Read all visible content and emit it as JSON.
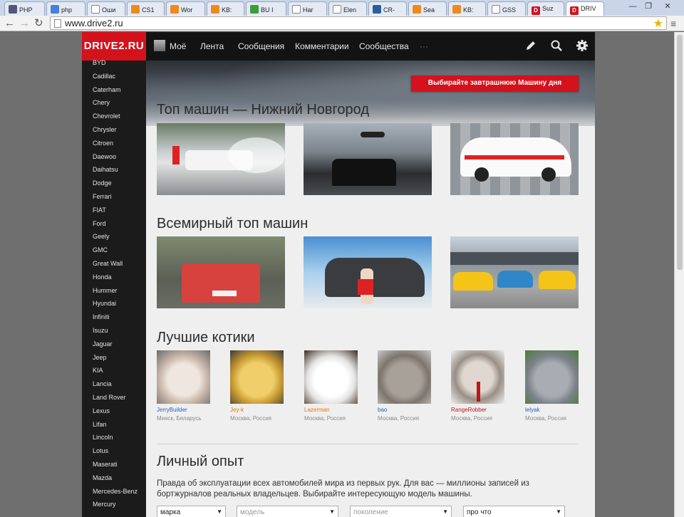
{
  "browser": {
    "tabs": [
      {
        "label": "PHP",
        "icon": "php-icon",
        "color": "#555577",
        "active": false
      },
      {
        "label": "php",
        "icon": "google-icon",
        "color": "#4a7fd8",
        "active": false
      },
      {
        "label": "Оши",
        "icon": "page-icon",
        "color": "#ffffff",
        "active": false
      },
      {
        "label": "CS1",
        "icon": "orange-icon",
        "color": "#ee8a1c",
        "active": false
      },
      {
        "label": "Wor",
        "icon": "orange-icon",
        "color": "#ee8a1c",
        "active": false
      },
      {
        "label": "KB:",
        "icon": "orange-icon",
        "color": "#ee8a1c",
        "active": false
      },
      {
        "label": "BU I",
        "icon": "check-icon",
        "color": "#3a9d3a",
        "active": false
      },
      {
        "label": "Har",
        "icon": "page-icon",
        "color": "#ffffff",
        "active": false
      },
      {
        "label": "Elen",
        "icon": "page-icon",
        "color": "#ffffff",
        "active": false
      },
      {
        "label": "CR-",
        "icon": "bird-icon",
        "color": "#2a5fa0",
        "active": false
      },
      {
        "label": "Sea",
        "icon": "orange-icon",
        "color": "#ee8a1c",
        "active": false
      },
      {
        "label": "KB:",
        "icon": "orange-icon",
        "color": "#ee8a1c",
        "active": false
      },
      {
        "label": "GSS",
        "icon": "page-icon",
        "color": "#ffffff",
        "active": false
      },
      {
        "label": "Suz",
        "icon": "drive2-icon",
        "color": "#d3121c",
        "active": false
      },
      {
        "label": "DRIV",
        "icon": "drive2-icon",
        "color": "#d3121c",
        "active": true
      }
    ],
    "url": "www.drive2.ru"
  },
  "site": {
    "logo": "DRIVE2.RU",
    "nav": [
      "Моё",
      "Лента",
      "Сообщения",
      "Комментарии",
      "Сообщества",
      "···"
    ],
    "accent": "#d3121c"
  },
  "sidebar": {
    "brands": [
      "BYD",
      "Cadillac",
      "Caterham",
      "Chery",
      "Chevrolet",
      "Chrysler",
      "Citroen",
      "Daewoo",
      "Daihatsu",
      "Dodge",
      "Ferrari",
      "FIAT",
      "Ford",
      "Geely",
      "GMC",
      "Great Wall",
      "Honda",
      "Hummer",
      "Hyundai",
      "Infiniti",
      "Isuzu",
      "Jaguar",
      "Jeep",
      "KIA",
      "Lancia",
      "Land Rover",
      "Lexus",
      "Lifan",
      "Lincoln",
      "Lotus",
      "Maserati",
      "Mazda",
      "Mercedes-Benz",
      "Mercury"
    ]
  },
  "main": {
    "hero_button": "Выбирайте завтрашнюю Машину дня",
    "section_local": "Топ машин — Нижний Новгород",
    "section_world": "Всемирный топ машин",
    "section_cats": "Лучшие котики",
    "cats": [
      {
        "name": "JerryBuilder",
        "location": "Минск, Беларусь",
        "color": "#2a62b8"
      },
      {
        "name": "Jey-k",
        "location": "Москва, Россия",
        "color": "#e07a00"
      },
      {
        "name": "Lazerman",
        "location": "Москва, Россия",
        "color": "#e07a00"
      },
      {
        "name": "bao",
        "location": "Москва, Россия",
        "color": "#2a62b8"
      },
      {
        "name": "RangeRobber",
        "location": "Москва, Россия",
        "color": "#c0141c"
      },
      {
        "name": "lelyak",
        "location": "Москва, Россия",
        "color": "#2a62b8"
      }
    ],
    "section_experience": "Личный опыт",
    "experience_text": "Правда об эксплуатации всех автомобилей мира из первых рук. Для вас — миллионы записей из бортжурналов реальных владельцев. Выбирайте интересующую модель машины.",
    "filters": [
      {
        "label": "марка",
        "placeholder": false
      },
      {
        "label": "модель",
        "placeholder": true
      },
      {
        "label": "поколение",
        "placeholder": true
      },
      {
        "label": "про что",
        "placeholder": false
      }
    ]
  }
}
